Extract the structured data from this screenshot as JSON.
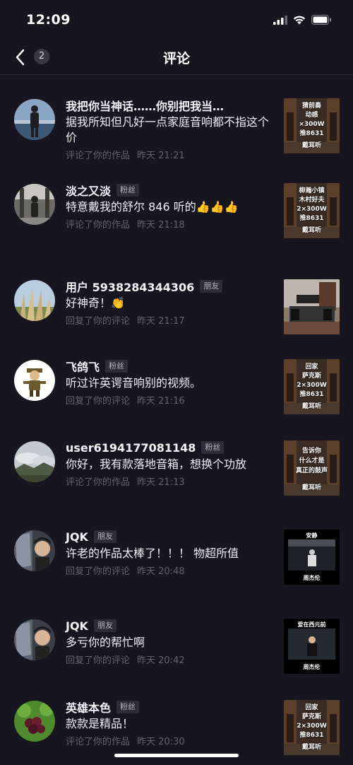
{
  "status": {
    "time": "12:09"
  },
  "nav": {
    "badge": "2",
    "title": "评论"
  },
  "items": [
    {
      "name": "我把你当神话……你别把我当…",
      "tag": "",
      "text": "据我所知但凡好一点家庭音响都不指这个价",
      "action": "评论了你的作品",
      "time": "昨天 21:21",
      "thumb": {
        "l1": "猜前奏",
        "l2": "动感",
        "l3": "×300W",
        "l4": "推8631",
        "l5": "戴耳听"
      }
    },
    {
      "name": "淡之又淡",
      "tag": "粉丝",
      "text": "特意戴我的舒尔 846 听的👍👍👍",
      "action": "评论了你的作品",
      "time": "昨天 21:18",
      "thumb": {
        "l1": "柳瀚小镇",
        "l2": "木村好夫",
        "l3": "2×300W",
        "l4": "推8631",
        "l5": "戴耳听"
      }
    },
    {
      "name": "用户 5938284344306",
      "tag": "朋友",
      "text": "好神奇！👏",
      "action": "回复了你的评论",
      "time": "昨天 21:17",
      "thumb": {
        "l1": "",
        "l2": "",
        "l3": "",
        "l4": "",
        "l5": ""
      }
    },
    {
      "name": "飞鸽飞",
      "tag": "粉丝",
      "text": "听过许英谔音响别的视频。",
      "action": "回复了你的评论",
      "time": "昨天 21:16",
      "thumb": {
        "l1": "回家",
        "l2": "萨克斯",
        "l3": "2×300W",
        "l4": "推8631",
        "l5": "戴耳听"
      }
    },
    {
      "name": "user6194177081148",
      "tag": "粉丝",
      "text": "你好，我有款落地音箱，想换个功放",
      "action": "评论了你的作品",
      "time": "昨天 21:13",
      "thumb": {
        "l1": "告诉你",
        "l2": "什么才是",
        "l3": "真正的鼓声",
        "l4": "",
        "l5": "戴耳听"
      }
    },
    {
      "name": "JQK",
      "tag": "朋友",
      "text": "许老的作品太棒了！！！ 物超所值",
      "action": "回复了你的评论",
      "time": "昨天 20:48",
      "thumb": {
        "l1": "安静",
        "l2": "",
        "l3": "",
        "l4": "",
        "l5": "周杰伦"
      }
    },
    {
      "name": "JQK",
      "tag": "朋友",
      "text": "多亏你的帮忙啊",
      "action": "回复了你的评论",
      "time": "昨天 20:42",
      "thumb": {
        "l1": "爱在西元前",
        "l2": "",
        "l3": "",
        "l4": "",
        "l5": "周杰伦"
      }
    },
    {
      "name": "英雄本色",
      "tag": "粉丝",
      "text": "款款是精品！",
      "action": "评论了你的作品",
      "time": "昨天 20:30",
      "thumb": {
        "l1": "回家",
        "l2": "萨克斯",
        "l3": "2×300W",
        "l4": "推8631",
        "l5": "戴耳听"
      }
    }
  ]
}
